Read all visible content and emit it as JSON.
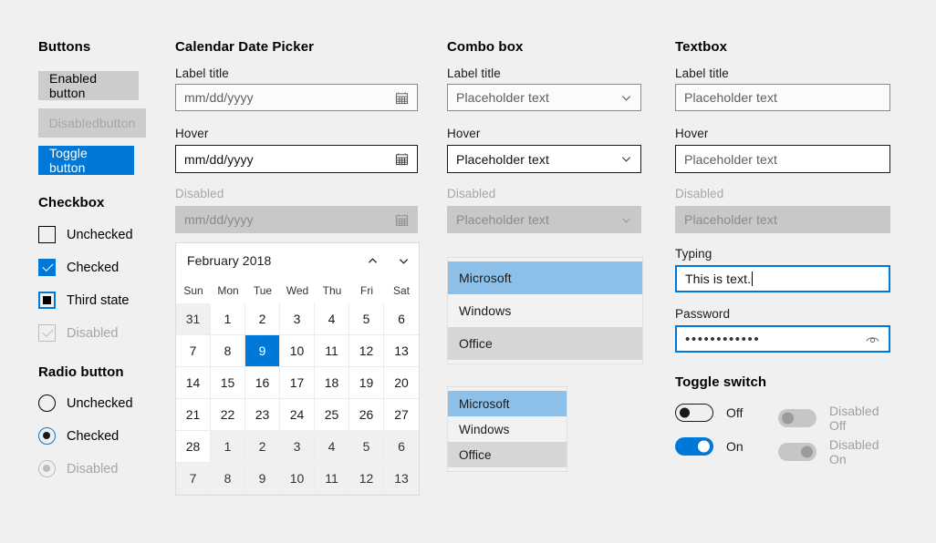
{
  "theme": {
    "background": "#f0f0f0",
    "accent": "#0078d7",
    "disabled_text": "#a6a6a6",
    "disabled_fill": "#c8c8c8",
    "list_selected": "#8cc0e8",
    "list_alt": "#d6d6d6"
  },
  "buttons": {
    "title": "Buttons",
    "enabled_label": "Enabled button",
    "disabled_label": "Disabledbutton",
    "toggle_label": "Toggle button"
  },
  "checkbox": {
    "title": "Checkbox",
    "items": [
      {
        "label": "Unchecked",
        "state": "unchecked"
      },
      {
        "label": "Checked",
        "state": "checked"
      },
      {
        "label": "Third state",
        "state": "third"
      },
      {
        "label": "Disabled",
        "state": "disabled"
      }
    ]
  },
  "radio": {
    "title": "Radio button",
    "items": [
      {
        "label": "Unchecked",
        "state": "unchecked"
      },
      {
        "label": "Checked",
        "state": "checked"
      },
      {
        "label": "Disabled",
        "state": "disabled"
      }
    ]
  },
  "datepicker": {
    "title": "Calendar Date Picker",
    "fields": [
      {
        "label": "Label title",
        "value": "mm/dd/yyyy",
        "state": "default",
        "icon": "calendar-icon"
      },
      {
        "label": "Hover",
        "value": "mm/dd/yyyy",
        "state": "hover",
        "icon": "calendar-icon"
      },
      {
        "label": "Disabled",
        "value": "mm/dd/yyyy",
        "state": "disabled",
        "icon": "calendar-icon"
      }
    ],
    "calendar": {
      "month_label": "February 2018",
      "prev_icon": "chevron-up-icon",
      "next_icon": "chevron-down-icon",
      "day_headers": [
        "Sun",
        "Mon",
        "Tue",
        "Wed",
        "Thu",
        "Fri",
        "Sat"
      ],
      "selected_day": 9,
      "weeks": [
        [
          {
            "d": "31",
            "out": true
          },
          {
            "d": "1"
          },
          {
            "d": "2"
          },
          {
            "d": "3"
          },
          {
            "d": "4"
          },
          {
            "d": "5"
          },
          {
            "d": "6"
          }
        ],
        [
          {
            "d": "7"
          },
          {
            "d": "8"
          },
          {
            "d": "9",
            "sel": true
          },
          {
            "d": "10"
          },
          {
            "d": "11"
          },
          {
            "d": "12"
          },
          {
            "d": "13"
          }
        ],
        [
          {
            "d": "14"
          },
          {
            "d": "15"
          },
          {
            "d": "16"
          },
          {
            "d": "17"
          },
          {
            "d": "18"
          },
          {
            "d": "19"
          },
          {
            "d": "20"
          }
        ],
        [
          {
            "d": "21"
          },
          {
            "d": "22"
          },
          {
            "d": "23"
          },
          {
            "d": "24"
          },
          {
            "d": "25"
          },
          {
            "d": "26"
          },
          {
            "d": "27"
          }
        ],
        [
          {
            "d": "28"
          },
          {
            "d": "1",
            "out": true
          },
          {
            "d": "2",
            "out": true
          },
          {
            "d": "3",
            "out": true
          },
          {
            "d": "4",
            "out": true
          },
          {
            "d": "5",
            "out": true
          },
          {
            "d": "6",
            "out": true
          }
        ],
        [
          {
            "d": "7",
            "out": true
          },
          {
            "d": "8",
            "out": true
          },
          {
            "d": "9",
            "out": true
          },
          {
            "d": "10",
            "out": true
          },
          {
            "d": "11",
            "out": true
          },
          {
            "d": "12",
            "out": true
          },
          {
            "d": "13",
            "out": true
          }
        ]
      ]
    }
  },
  "combobox": {
    "title": "Combo box",
    "fields": [
      {
        "label": "Label title",
        "value": "Placeholder text",
        "state": "default",
        "icon": "chevron-down-icon"
      },
      {
        "label": "Hover",
        "value": "Placeholder text",
        "state": "hover",
        "icon": "chevron-down-icon"
      },
      {
        "label": "Disabled",
        "value": "Placeholder text",
        "state": "disabled",
        "icon": "chevron-down-icon"
      }
    ],
    "list_wide": {
      "items": [
        "Microsoft",
        "Windows",
        "Office"
      ],
      "selected_index": 0
    },
    "list_narrow": {
      "items": [
        "Microsoft",
        "Windows",
        "Office"
      ],
      "selected_index": 0
    }
  },
  "textbox": {
    "title": "Textbox",
    "fields": [
      {
        "label": "Label title",
        "value": "Placeholder text",
        "state": "default"
      },
      {
        "label": "Hover",
        "value": "Placeholder text",
        "state": "hover"
      },
      {
        "label": "Disabled",
        "value": "Placeholder text",
        "state": "disabled"
      },
      {
        "label": "Typing",
        "value": "This is text.",
        "state": "focus"
      }
    ],
    "password": {
      "label": "Password",
      "masked_value": "••••••••••••",
      "reveal_icon": "eye-icon"
    }
  },
  "toggle": {
    "title": "Toggle switch",
    "items": [
      {
        "label": "Off",
        "state": "off"
      },
      {
        "label": "Disabled Off",
        "state": "disabled-off"
      },
      {
        "label": "On",
        "state": "on"
      },
      {
        "label": "Disabled On",
        "state": "disabled-on"
      }
    ]
  }
}
